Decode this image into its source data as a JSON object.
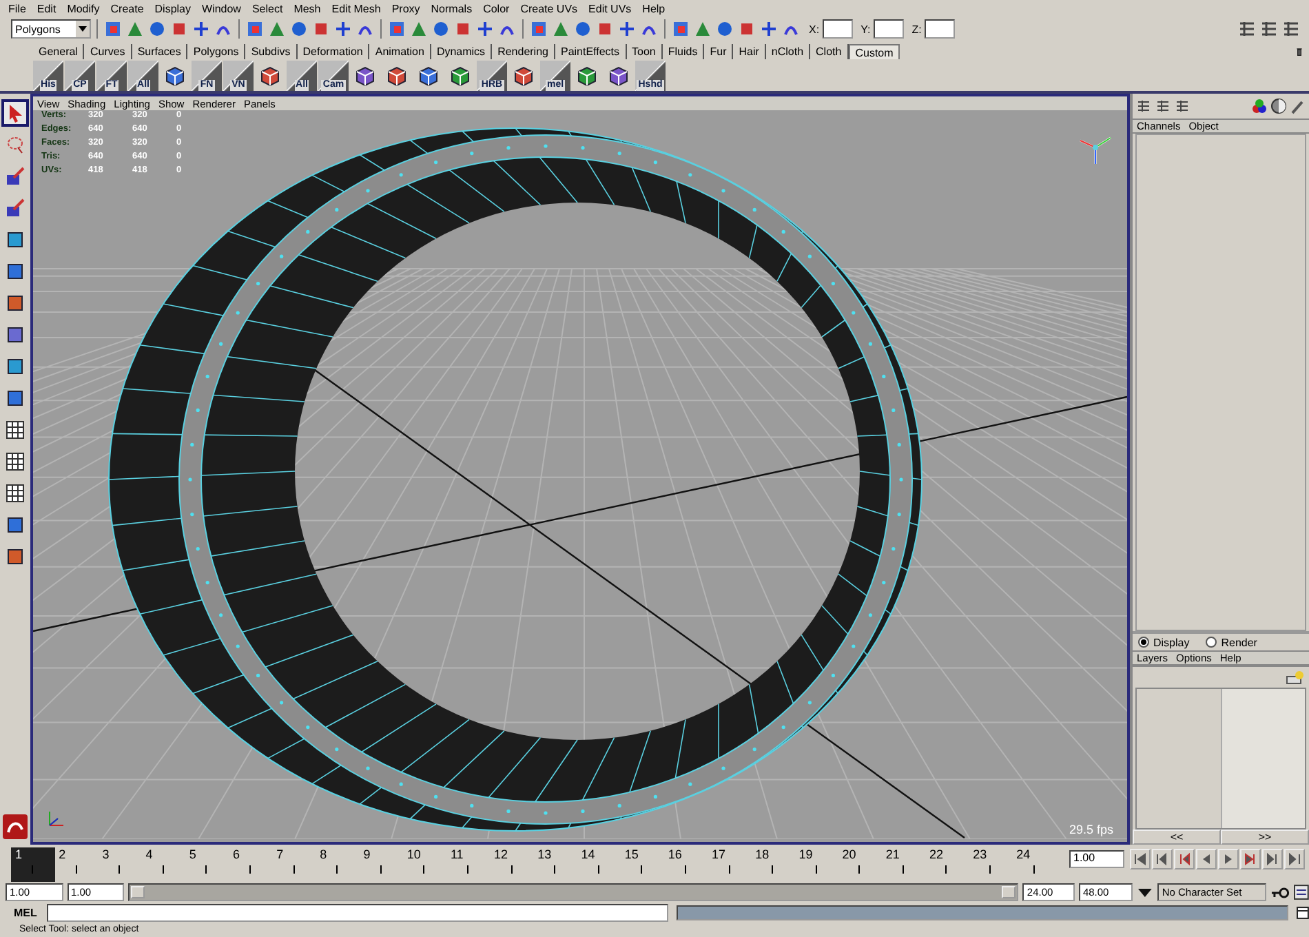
{
  "menu_bar": [
    "File",
    "Edit",
    "Modify",
    "Create",
    "Display",
    "Window",
    "Select",
    "Mesh",
    "Edit Mesh",
    "Proxy",
    "Normals",
    "Color",
    "Create UVs",
    "Edit UVs",
    "Help"
  ],
  "status_line": {
    "menu_set": "Polygons",
    "fields": [
      {
        "label": "X:"
      },
      {
        "label": "Y:"
      },
      {
        "label": "Z:"
      }
    ]
  },
  "shelf": {
    "tabs": [
      {
        "label": "General",
        "selected": false
      },
      {
        "label": "Curves",
        "selected": false
      },
      {
        "label": "Surfaces",
        "selected": false
      },
      {
        "label": "Polygons",
        "selected": false
      },
      {
        "label": "Subdivs",
        "selected": false
      },
      {
        "label": "Deformation",
        "selected": false
      },
      {
        "label": "Animation",
        "selected": false
      },
      {
        "label": "Dynamics",
        "selected": false
      },
      {
        "label": "Rendering",
        "selected": false
      },
      {
        "label": "PaintEffects",
        "selected": false
      },
      {
        "label": "Toon",
        "selected": false
      },
      {
        "label": "Fluids",
        "selected": false
      },
      {
        "label": "Fur",
        "selected": false
      },
      {
        "label": "Hair",
        "selected": false
      },
      {
        "label": "nCloth",
        "selected": false
      },
      {
        "label": "Cloth",
        "selected": false
      },
      {
        "label": "Custom",
        "selected": true
      }
    ],
    "items": [
      {
        "kind": "labeled",
        "label": "His"
      },
      {
        "kind": "labeled",
        "label": "CP"
      },
      {
        "kind": "labeled",
        "label": "FT"
      },
      {
        "kind": "labeled",
        "label": "All"
      },
      {
        "kind": "plain"
      },
      {
        "kind": "labeled",
        "label": "FN"
      },
      {
        "kind": "labeled",
        "label": "VN"
      },
      {
        "kind": "plain"
      },
      {
        "kind": "labeled",
        "label": "All"
      },
      {
        "kind": "labeled",
        "label": "Cam"
      },
      {
        "kind": "plain"
      },
      {
        "kind": "plain"
      },
      {
        "kind": "plain"
      },
      {
        "kind": "plain"
      },
      {
        "kind": "labeled",
        "label": "HRB"
      },
      {
        "kind": "plain"
      },
      {
        "kind": "labeled",
        "label": "mel"
      },
      {
        "kind": "plain"
      },
      {
        "kind": "plain"
      },
      {
        "kind": "labeled",
        "label": "Hshd"
      }
    ]
  },
  "viewport": {
    "menu": [
      "View",
      "Shading",
      "Lighting",
      "Show",
      "Renderer",
      "Panels"
    ],
    "stats": [
      {
        "label": "Verts:",
        "values": [
          "320",
          "320",
          "0"
        ]
      },
      {
        "label": "Edges:",
        "values": [
          "640",
          "640",
          "0"
        ]
      },
      {
        "label": "Faces:",
        "values": [
          "320",
          "320",
          "0"
        ]
      },
      {
        "label": "Tris:",
        "values": [
          "640",
          "640",
          "0"
        ]
      },
      {
        "label": "UVs:",
        "values": [
          "418",
          "418",
          "0"
        ]
      }
    ],
    "fps": "29.5 fps"
  },
  "channel_box": {
    "menu": [
      "Channels",
      "Object"
    ]
  },
  "layer_editor": {
    "modes": [
      {
        "label": "Display",
        "selected": true
      },
      {
        "label": "Render",
        "selected": false
      }
    ],
    "menu": [
      "Layers",
      "Options",
      "Help"
    ],
    "scroll_buttons": [
      "<<",
      ">>"
    ]
  },
  "time_slider": {
    "frames": [
      {
        "label": "1",
        "selected": true
      },
      {
        "label": "2",
        "selected": false
      },
      {
        "label": "3",
        "selected": false
      },
      {
        "label": "4",
        "selected": false
      },
      {
        "label": "5",
        "selected": false
      },
      {
        "label": "6",
        "selected": false
      },
      {
        "label": "7",
        "selected": false
      },
      {
        "label": "8",
        "selected": false
      },
      {
        "label": "9",
        "selected": false
      },
      {
        "label": "10",
        "selected": false
      },
      {
        "label": "11",
        "selected": false
      },
      {
        "label": "12",
        "selected": false
      },
      {
        "label": "13",
        "selected": false
      },
      {
        "label": "14",
        "selected": false
      },
      {
        "label": "15",
        "selected": false
      },
      {
        "label": "16",
        "selected": false
      },
      {
        "label": "17",
        "selected": false
      },
      {
        "label": "18",
        "selected": false
      },
      {
        "label": "19",
        "selected": false
      },
      {
        "label": "20",
        "selected": false
      },
      {
        "label": "21",
        "selected": false
      },
      {
        "label": "22",
        "selected": false
      },
      {
        "label": "23",
        "selected": false
      },
      {
        "label": "24",
        "selected": false
      }
    ],
    "current_time": "1.00"
  },
  "range_slider": {
    "start": "1.00",
    "range_start": "1.00",
    "range_end": "24.00",
    "end": "48.00",
    "character_set": "No Character Set"
  },
  "command_line": {
    "label": "MEL"
  },
  "help_line": "Select Tool: select an object"
}
